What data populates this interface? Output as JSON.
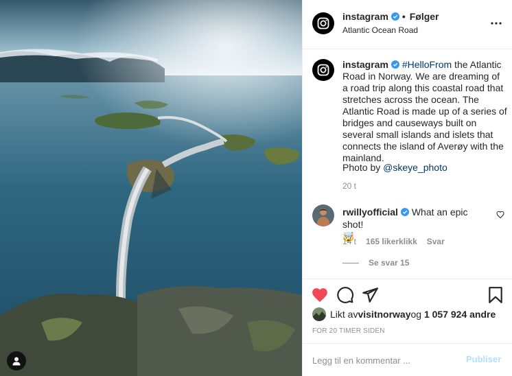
{
  "header": {
    "username": "instagram",
    "separator": "•",
    "follow_label": "Følger",
    "location": "Atlantic Ocean Road",
    "more_icon": "more-horizontal-icon"
  },
  "caption": {
    "username": "instagram",
    "hashtag": "#HelloFrom",
    "text": " the Atlantic Road in Norway. We are dreaming of a road trip along this coastal road that stretches across the ocean. The Atlantic Road is made up of a series of bridges and causeways built on several small islands and islets that connects the island of Averøy with the mainland.",
    "photo_prefix": "Photo by ",
    "photo_mention": "@skeye_photo",
    "time": "20 t"
  },
  "comment": {
    "username": "rwillyofficial",
    "text": "What an epic shot!",
    "emoji": "🤯",
    "time": "14 t",
    "likes": "165 likerklikk",
    "reply_label": "Svar",
    "view_replies": "Se svar 15"
  },
  "likes": {
    "prefix": "Likt av ",
    "user": "visitnorway",
    "middle": " og ",
    "count": "1 057 924 andre"
  },
  "post_time": "FOR 20 TIMER SIDEN",
  "comment_box": {
    "placeholder": "Legg til en kommentar ...",
    "publish_label": "Publiser"
  },
  "colors": {
    "like_red": "#ed4956",
    "verified_blue": "#3897f0",
    "link_blue": "#00376b",
    "publish_disabled": "#b2dffc"
  }
}
